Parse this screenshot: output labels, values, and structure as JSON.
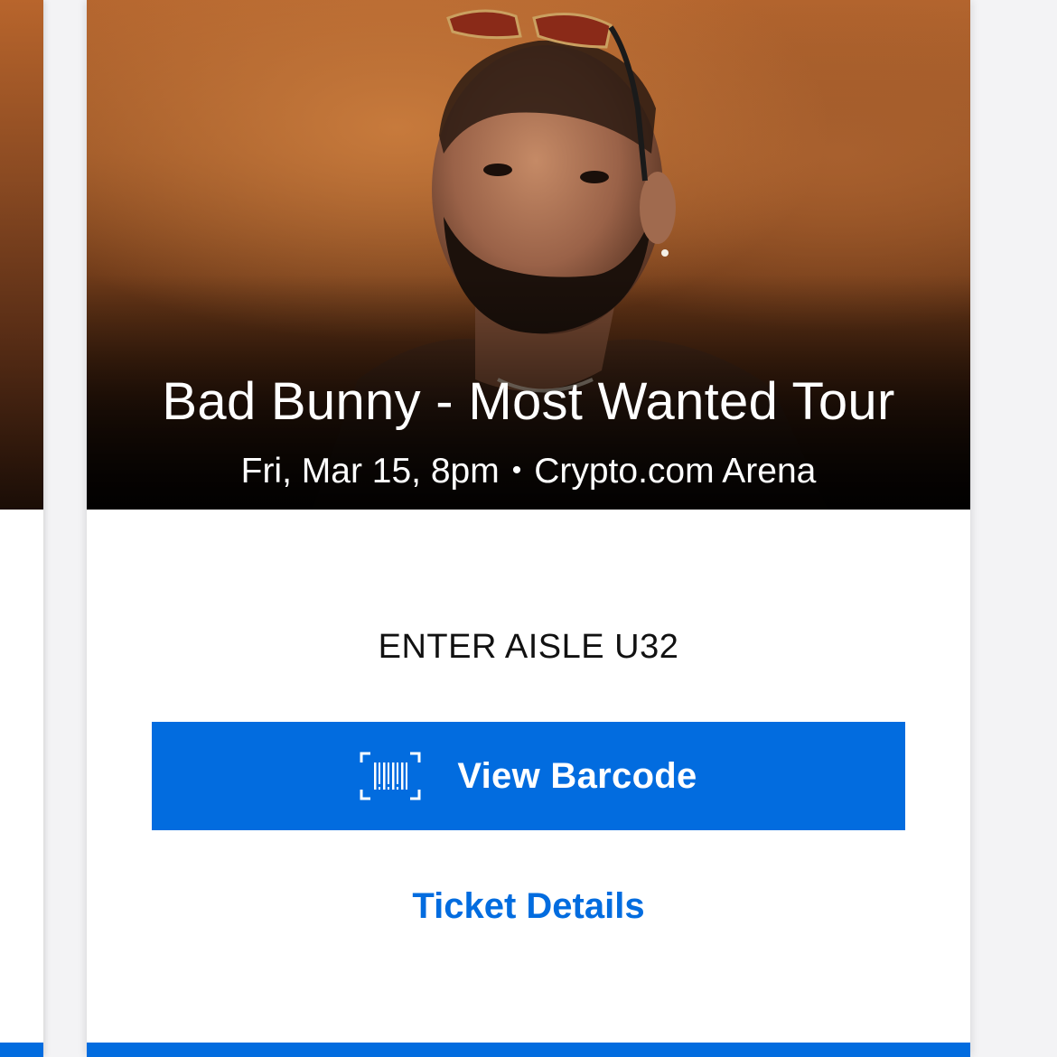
{
  "event": {
    "title": "Bad Bunny - Most Wanted Tour",
    "date_time": "Fri, Mar 15, 8pm",
    "separator": "•",
    "venue": "Crypto.com Arena"
  },
  "ticket": {
    "entry": "ENTER AISLE U32",
    "barcode_button_label": "View Barcode",
    "barcode_icon": "barcode-scan-icon",
    "details_link_label": "Ticket Details"
  },
  "colors": {
    "accent": "#026cdf",
    "text_dark": "#111111",
    "card_bg": "#ffffff"
  }
}
